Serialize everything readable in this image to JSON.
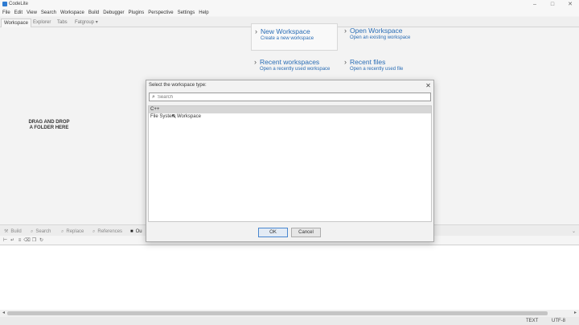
{
  "app": {
    "title": "CodeLite"
  },
  "window_controls": {
    "minimize": "–",
    "maximize": "□",
    "close": "✕"
  },
  "menu": [
    "File",
    "Edit",
    "View",
    "Search",
    "Workspace",
    "Build",
    "Debugger",
    "Plugins",
    "Perspective",
    "Settings",
    "Help"
  ],
  "tabs": {
    "workspace": "Workspace",
    "explorer": "Explorer",
    "tabs": "Tabs",
    "fatgroup": "Fatgroup",
    "fatgroup_chevron": "▾"
  },
  "drag_drop": {
    "line1": "DRAG AND DROP",
    "line2": "A FOLDER HERE"
  },
  "welcome": {
    "new_workspace": {
      "title": "New Workspace",
      "subtitle": "Create a new workspace"
    },
    "open_workspace": {
      "title": "Open Workspace",
      "subtitle": "Open an existing workspace"
    },
    "recent_workspaces": {
      "title": "Recent workspaces",
      "subtitle": "Open a recently used workspace"
    },
    "recent_files": {
      "title": "Recent files",
      "subtitle": "Open a recently used file"
    }
  },
  "bottom_tabs": {
    "build": "Build",
    "search": "Search",
    "replace": "Replace",
    "references": "References",
    "output": "Ou"
  },
  "status": {
    "text": "TEXT",
    "encoding": "UTF-8"
  },
  "dialog": {
    "title": "Select the workspace type:",
    "close": "✕",
    "search_placeholder": "Search",
    "items": [
      "C++",
      "File System Workspace"
    ],
    "ok": "OK",
    "cancel": "Cancel"
  },
  "colors": {
    "link": "#2a6db5",
    "accent": "#4a87cf"
  }
}
